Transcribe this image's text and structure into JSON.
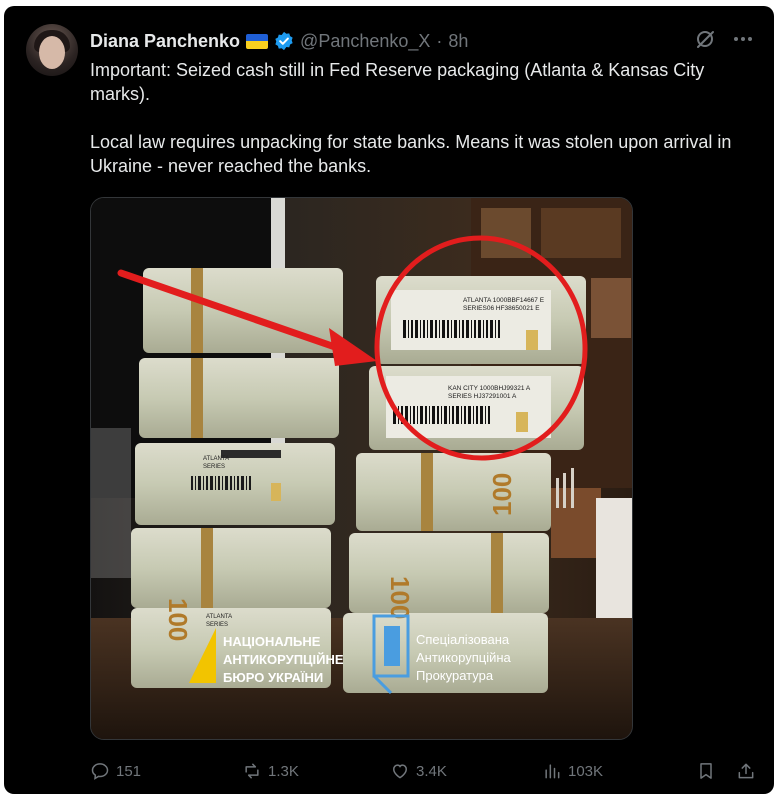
{
  "author": {
    "name": "Diana Panchenko",
    "handle": "@Panchenko_X",
    "separator": "·",
    "time": "8h",
    "flag": "ukraine-flag-icon",
    "verified": "verified-badge-icon"
  },
  "tweet": {
    "text": "Important: Seized cash still in Fed Reserve packaging (Atlanta & Kansas City marks).\n\nLocal law requires unpacking for state banks. Means it was stolen upon arrival in Ukraine - never reached the banks."
  },
  "media": {
    "stacks": {
      "left": {
        "band1": {
          "line1": "ATLANTA",
          "line2": "SERIES"
        },
        "band2": {
          "line1": "ATLANTA",
          "line2": "SERIES"
        }
      },
      "right": {
        "atlanta": {
          "line1": "ATLANTA 1000BBF14667 E",
          "line2": "SERIES06 HF38650021 E"
        },
        "kansas": {
          "line1": "KAN CITY 1000BHJ99321 A",
          "line2": "SERIES HJ37291001 A"
        }
      }
    },
    "denomination": "100",
    "logos": {
      "nabu": [
        "НАЦІОНАЛЬНЕ",
        "АНТИКОРУПЦІЙНЕ",
        "БЮРО УКРАЇНИ"
      ],
      "sap": [
        "Спеціалізована",
        "Антикорупційна",
        "Прокуратура"
      ]
    }
  },
  "actions": {
    "reply": "151",
    "repost": "1.3K",
    "like": "3.4K",
    "views": "103K"
  },
  "colors": {
    "background": "#000000",
    "text": "#e7e9ea",
    "muted": "#71767b",
    "verified": "#1d9bf0",
    "annotation_red": "#e21d1d"
  }
}
